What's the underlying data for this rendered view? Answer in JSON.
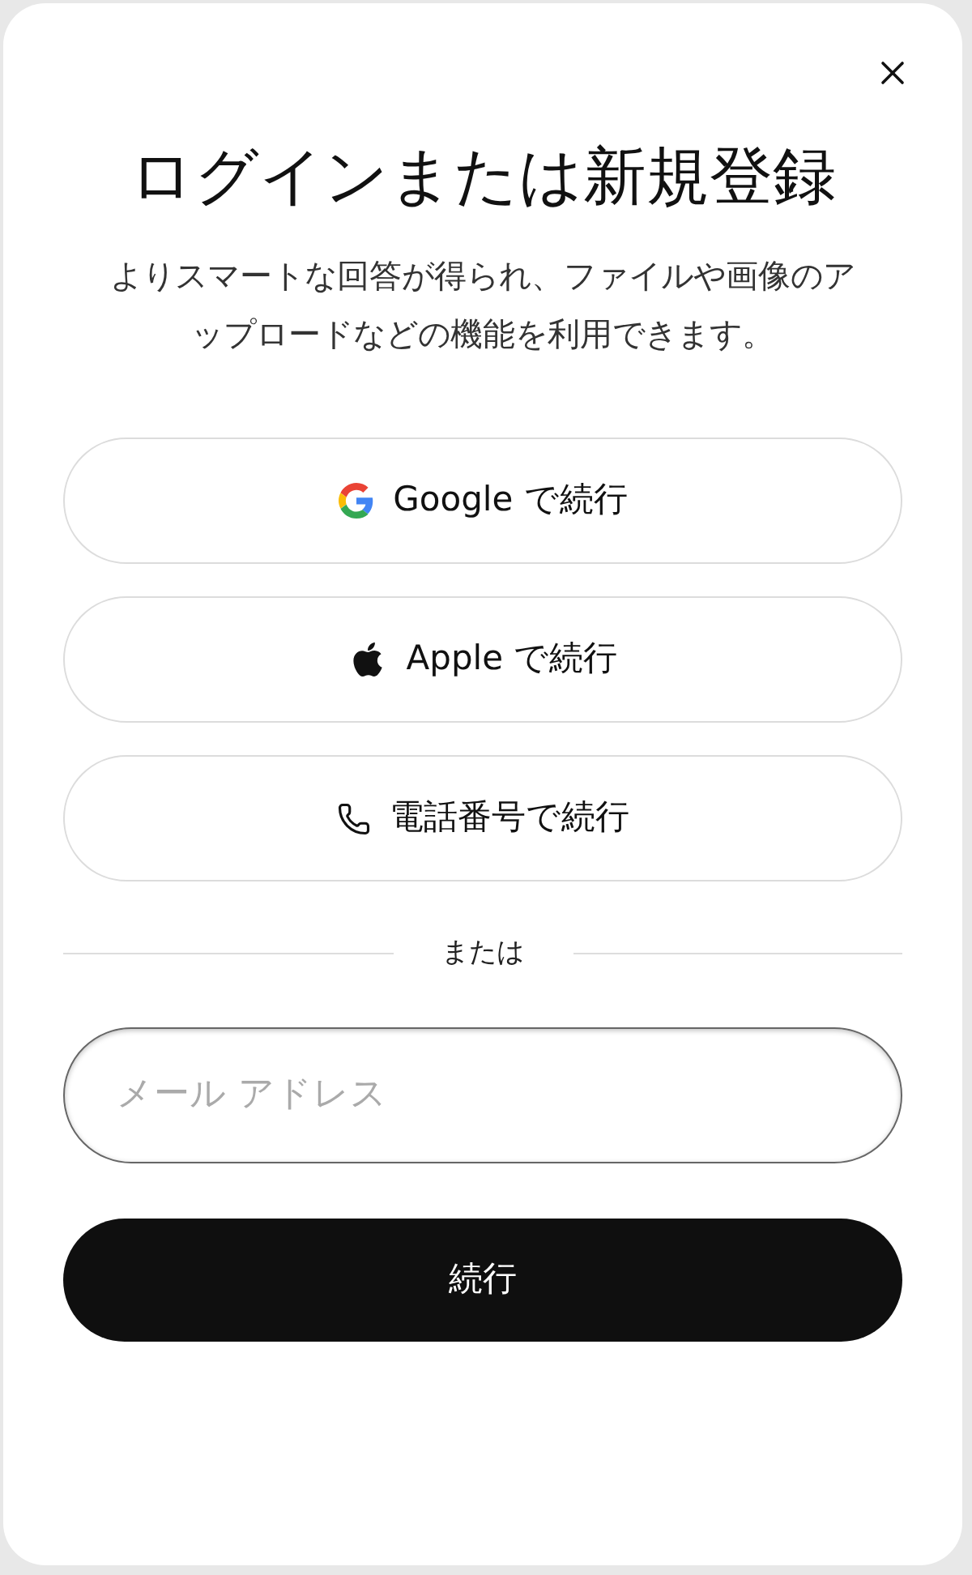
{
  "dialog": {
    "title": "ログインまたは新規登録",
    "description": "よりスマートな回答が得られ、ファイルや画像のアップロードなどの機能を利用できます。",
    "providers": [
      {
        "kind": "google",
        "label": "Google で続行"
      },
      {
        "kind": "apple",
        "label": "Apple で続行"
      },
      {
        "kind": "phone",
        "label": "電話番号で続行"
      }
    ],
    "divider": "または",
    "email": {
      "placeholder": "メール アドレス"
    },
    "submit": "続行"
  }
}
